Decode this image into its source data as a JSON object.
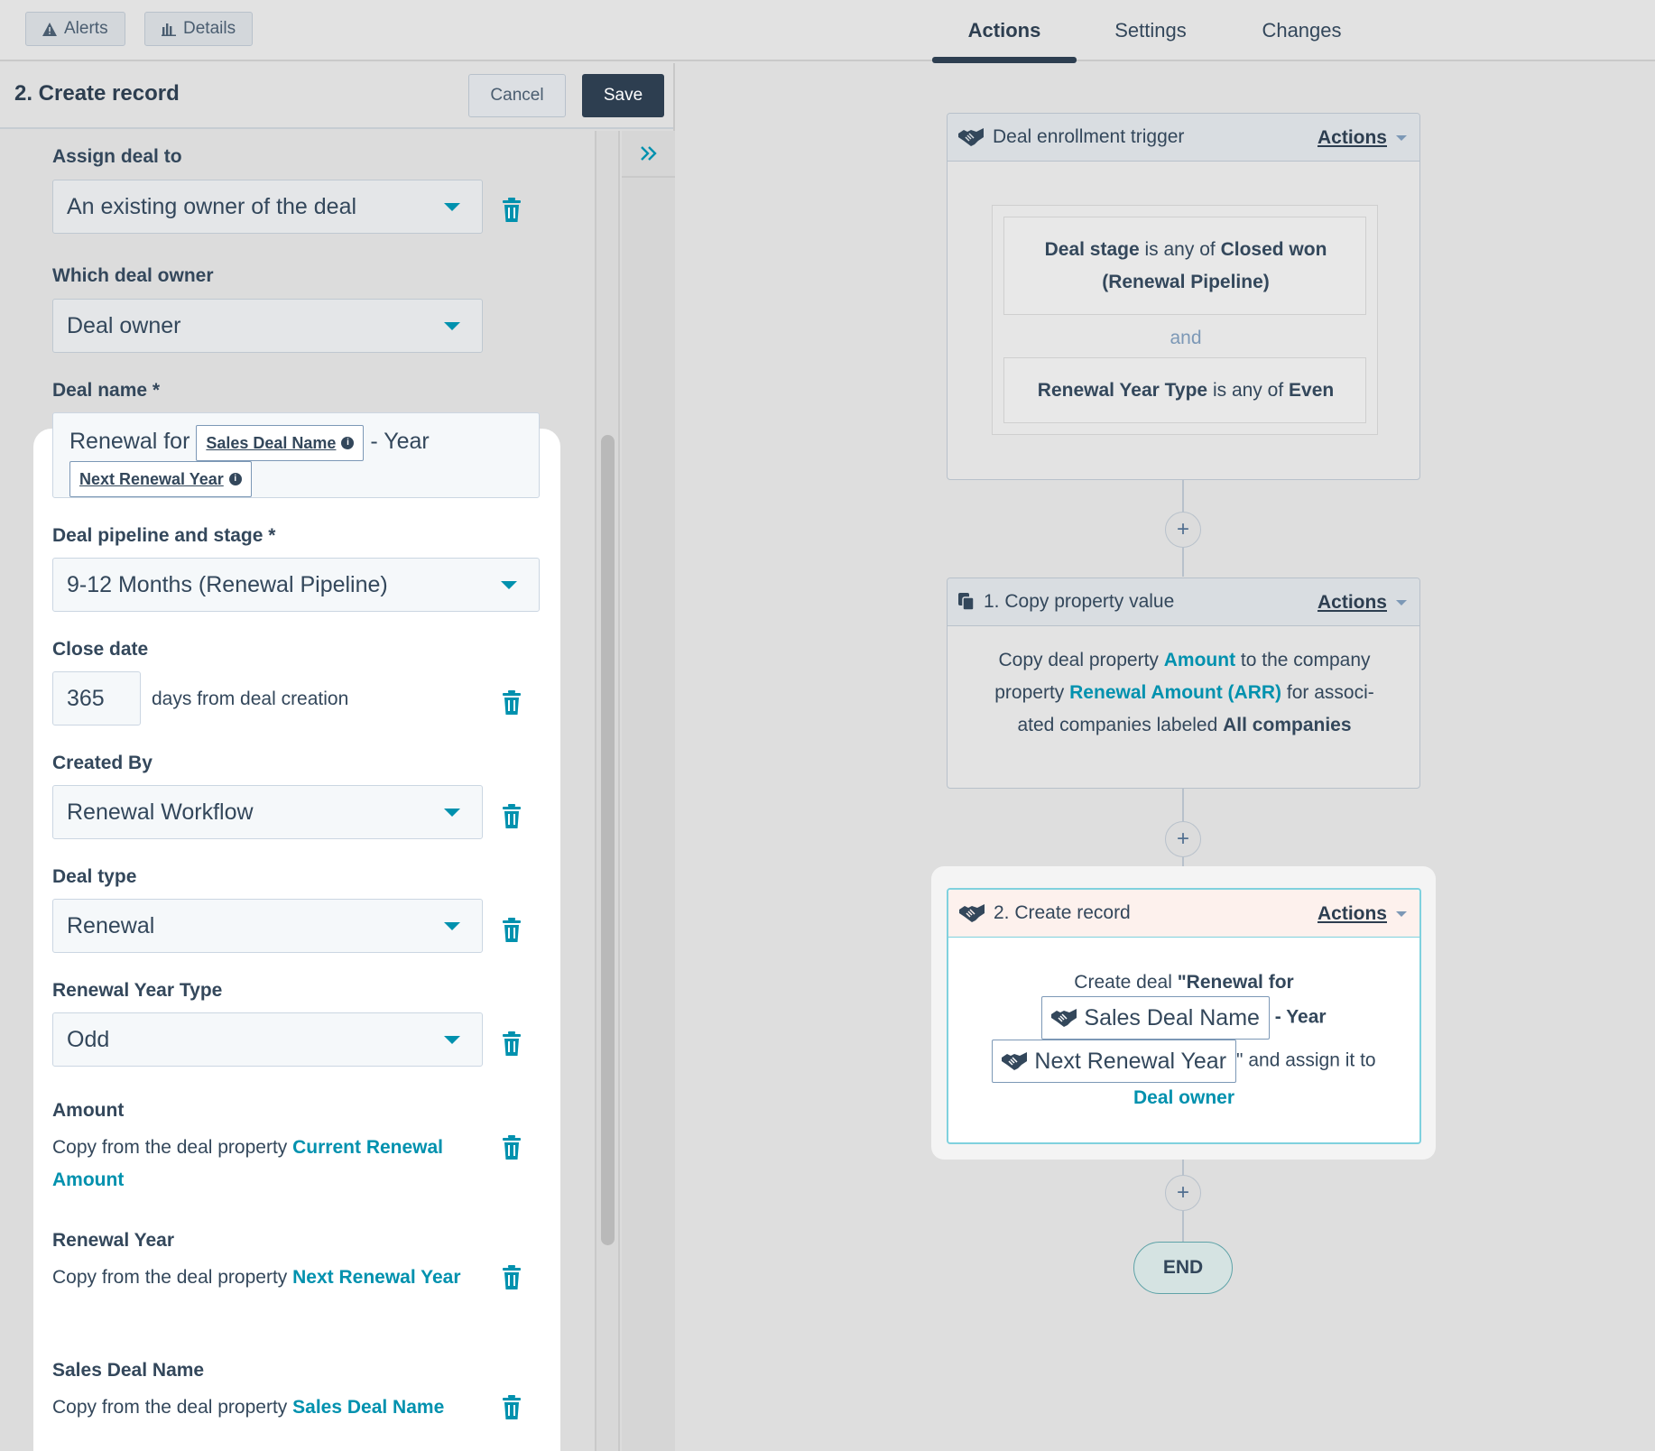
{
  "topbar": {
    "alerts_label": "Alerts",
    "details_label": "Details",
    "tabs": [
      {
        "label": "Actions",
        "active": true
      },
      {
        "label": "Settings",
        "active": false
      },
      {
        "label": "Changes",
        "active": false
      }
    ]
  },
  "panel": {
    "title": "2. Create record",
    "cancel_label": "Cancel",
    "save_label": "Save",
    "collapse_icon": "double-chevron-right"
  },
  "form": {
    "assign_deal": {
      "label": "Assign deal to",
      "value": "An existing owner of the deal"
    },
    "which_owner": {
      "label": "Which deal owner",
      "value": "Deal owner"
    },
    "deal_name": {
      "label": "Deal name *",
      "prefix": "Renewal for",
      "token1": "Sales Deal Name",
      "middle": "- Year",
      "token2": "Next Renewal Year"
    },
    "pipeline": {
      "label": "Deal pipeline and stage *",
      "value": "9-12 Months (Renewal Pipeline)"
    },
    "close_date": {
      "label": "Close date",
      "value": "365",
      "suffix": "days from deal creation"
    },
    "created_by": {
      "label": "Created By",
      "value": "Renewal Workflow"
    },
    "deal_type": {
      "label": "Deal type",
      "value": "Renewal"
    },
    "renewal_year_type": {
      "label": "Renewal Year Type",
      "value": "Odd"
    },
    "amount": {
      "label": "Amount",
      "prefix": "Copy from the deal property",
      "link": "Current Renewal Amount"
    },
    "renewal_year": {
      "label": "Renewal Year",
      "prefix": "Copy from the deal property",
      "link": "Next Renewal Year"
    },
    "sales_deal_name": {
      "label": "Sales Deal Name",
      "prefix": "Copy from the deal property",
      "link": "Sales Deal Name"
    }
  },
  "workflow": {
    "trigger": {
      "title": "Deal enrollment trigger",
      "actions_label": "Actions",
      "cond1": {
        "field": "Deal stage",
        "op": "is any of",
        "value": "Closed won (Renewal Pipeline)"
      },
      "joiner": "and",
      "cond2": {
        "field": "Renewal Year Type",
        "op": "is any of",
        "value": "Even"
      }
    },
    "step1": {
      "title": "1. Copy property value",
      "actions_label": "Actions",
      "t1": "Copy deal property",
      "l1": "Amount",
      "t2": "to the company",
      "t3": "property",
      "l2": "Renewal Amount (ARR)",
      "t4": "for associ-",
      "t5": "ated companies labeled",
      "b1": "All companies"
    },
    "step2": {
      "title": "2. Create record",
      "actions_label": "Actions",
      "t1": "Create deal",
      "b1": "\"Renewal for",
      "chip1": "Sales Deal Name",
      "b2": "- Year",
      "chip2": "Next Renewal Year",
      "t2": "\" and assign it to",
      "l1": "Deal owner"
    },
    "end_label": "END",
    "colors": {
      "accent": "#0091ae",
      "dark": "#2d3e50",
      "selected_border": "#7fd1de",
      "selected_head": "#fdf1ed"
    }
  }
}
